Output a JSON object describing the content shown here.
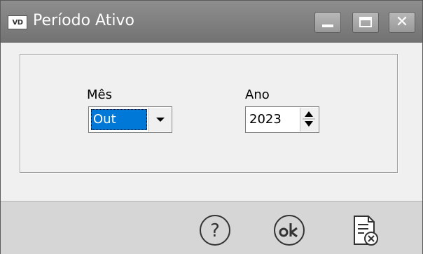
{
  "window": {
    "icon_text": "VD",
    "title": "Período Ativo",
    "controls": [
      "minimize-icon",
      "maximize-icon",
      "close-icon"
    ]
  },
  "form": {
    "month_label": "Mês",
    "month_value": "Out",
    "year_label": "Ano",
    "year_value": "2023"
  },
  "footer": {
    "help_icon": "help-icon",
    "ok_icon": "ok-icon",
    "cancel_icon": "cancel-document-icon"
  }
}
